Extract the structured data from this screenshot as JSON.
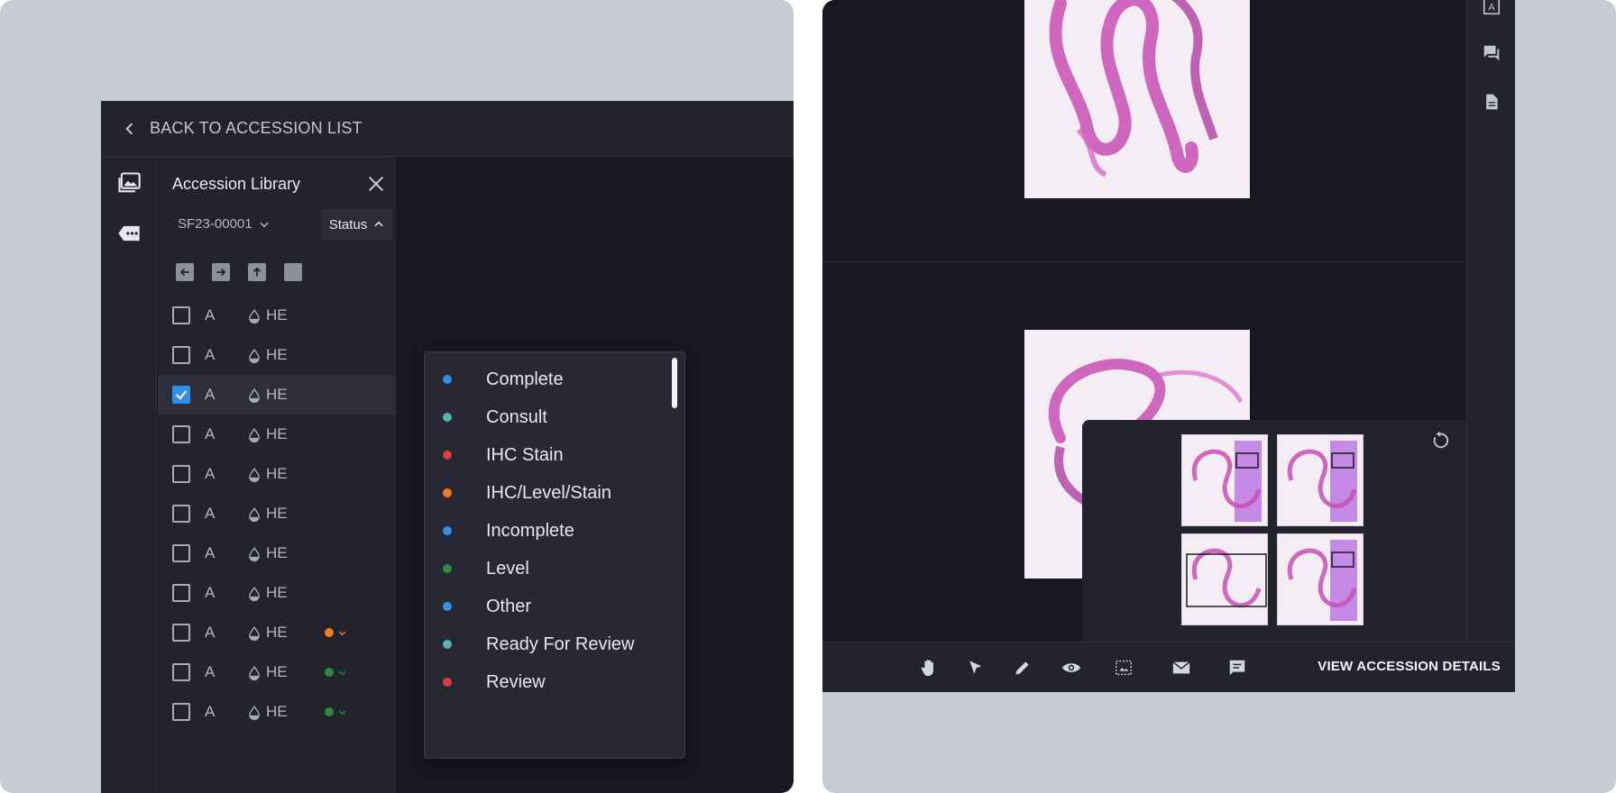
{
  "left_panel": {
    "back_label": "BACK TO ACCESSION LIST",
    "library_title": "Accession Library",
    "accession_select": "SF23-00001",
    "status_button": "Status",
    "rows": [
      {
        "block": "A",
        "stain": "HE",
        "checked": false,
        "status_color": ""
      },
      {
        "block": "A",
        "stain": "HE",
        "checked": false,
        "status_color": ""
      },
      {
        "block": "A",
        "stain": "HE",
        "checked": true,
        "status_color": ""
      },
      {
        "block": "A",
        "stain": "HE",
        "checked": false,
        "status_color": ""
      },
      {
        "block": "A",
        "stain": "HE",
        "checked": false,
        "status_color": ""
      },
      {
        "block": "A",
        "stain": "HE",
        "checked": false,
        "status_color": ""
      },
      {
        "block": "A",
        "stain": "HE",
        "checked": false,
        "status_color": ""
      },
      {
        "block": "A",
        "stain": "HE",
        "checked": false,
        "status_color": ""
      },
      {
        "block": "A",
        "stain": "HE",
        "checked": false,
        "status_color": "#f47a1f"
      },
      {
        "block": "A",
        "stain": "HE",
        "checked": false,
        "status_color": "#2e8b3e"
      },
      {
        "block": "A",
        "stain": "HE",
        "checked": false,
        "status_color": "#2e8b3e"
      }
    ],
    "status_options": [
      {
        "label": "Complete",
        "color": "#2f8fe9"
      },
      {
        "label": "Consult",
        "color": "#5fb0b7"
      },
      {
        "label": "IHC Stain",
        "color": "#e03c3c"
      },
      {
        "label": "IHC/Level/Stain",
        "color": "#f47a1f"
      },
      {
        "label": "Incomplete",
        "color": "#2f8fe9"
      },
      {
        "label": "Level",
        "color": "#2e8b3e"
      },
      {
        "label": "Other",
        "color": "#2f8fe9"
      },
      {
        "label": "Ready For Review",
        "color": "#5fb0b7"
      },
      {
        "label": "Review",
        "color": "#e03c3c"
      }
    ]
  },
  "right_panel": {
    "view_details_label": "VIEW ACCESSION DETAILS",
    "toolbar_icons": [
      "hand-icon",
      "pointer-icon",
      "pencil-icon",
      "eye-icon",
      "region-icon",
      "mail-icon",
      "comment-icon"
    ],
    "rail_icons": [
      "text-box-icon",
      "chat-icon",
      "document-icon"
    ]
  }
}
